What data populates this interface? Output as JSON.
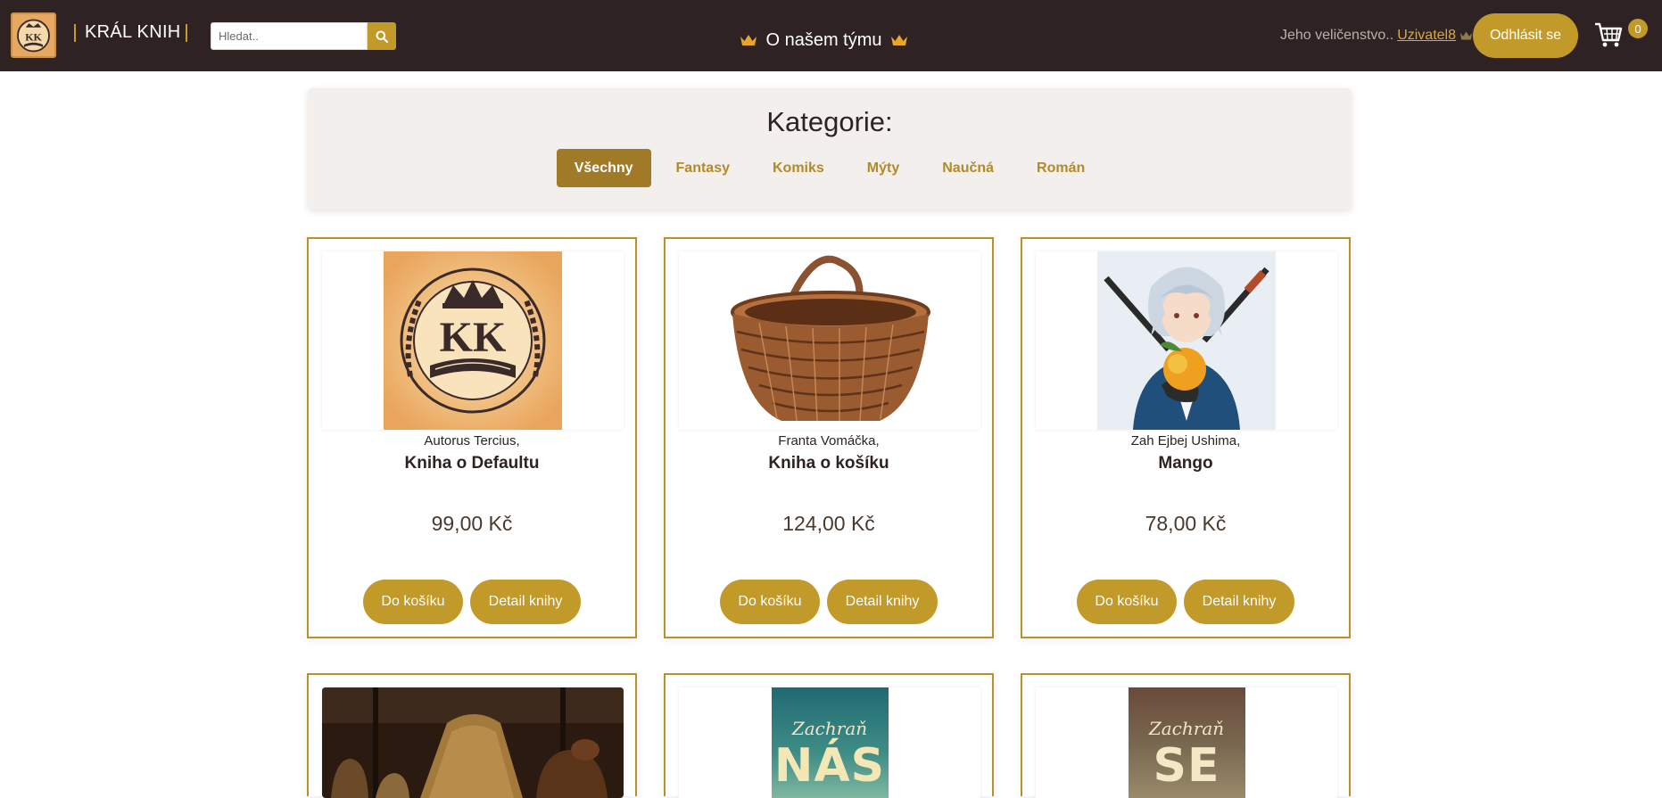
{
  "header": {
    "brand": "KRÁL KNIH",
    "logo_text": "KK",
    "search_placeholder": "Hledat..",
    "team_link": "O našem týmu",
    "greeting": "Jeho veličenstvo..",
    "username": "Uzivatel8",
    "logout": "Odhlásit se",
    "cart_count": "0"
  },
  "categories": {
    "title": "Kategorie:",
    "items": [
      "Všechny",
      "Fantasy",
      "Komiks",
      "Mýty",
      "Naučná",
      "Román"
    ],
    "active": "Všechny"
  },
  "products": [
    {
      "author": "Autorus Tercius,",
      "title": "Kniha o Defaultu",
      "price": "99,00 Kč",
      "image": "kk-logo-cover",
      "add_to_cart": "Do košíku",
      "detail": "Detail knihy"
    },
    {
      "author": "Franta Vomáčka,",
      "title": "Kniha o košíku",
      "price": "124,00 Kč",
      "image": "wicker-basket-cover",
      "add_to_cart": "Do košíku",
      "detail": "Detail knihy"
    },
    {
      "author": "Zah Ejbej Ushima,",
      "title": "Mango",
      "price": "78,00 Kč",
      "image": "anime-swordsman-cover",
      "add_to_cart": "Do košíku",
      "detail": "Detail knihy"
    },
    {
      "image": "prehistoric-hut-cover"
    },
    {
      "image": "zachran-nas-cover",
      "cover_script": "Zachraň",
      "cover_big": "NÁS"
    },
    {
      "image": "zachran-se-cover",
      "cover_script": "Zachraň",
      "cover_big": "SE"
    }
  ],
  "colors": {
    "navbar_bg": "#2e2322",
    "accent_gold": "#c29a2a",
    "active_tab": "#a07a26",
    "card_border": "#b8912c"
  }
}
